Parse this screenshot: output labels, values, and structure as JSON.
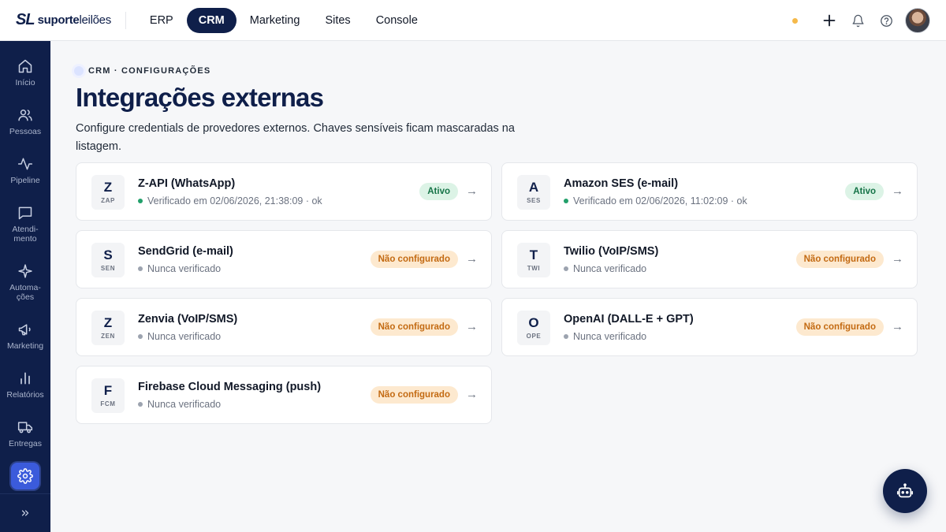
{
  "brand": {
    "mark": "SL",
    "name_bold": "suporte",
    "name_light": "leilões"
  },
  "topnav": {
    "items": [
      {
        "label": "ERP",
        "active": false
      },
      {
        "label": "CRM",
        "active": true
      },
      {
        "label": "Marketing",
        "active": false
      },
      {
        "label": "Sites",
        "active": false
      },
      {
        "label": "Console",
        "active": false
      }
    ]
  },
  "sidebar": {
    "items": [
      {
        "label": "Início",
        "icon": "home-icon"
      },
      {
        "label": "Pessoas",
        "icon": "people-icon"
      },
      {
        "label": "Pipeline",
        "icon": "pulse-icon"
      },
      {
        "label": "Atendi-\nmento",
        "icon": "chat-icon"
      },
      {
        "label": "Automa-\nções",
        "icon": "sparkle-icon"
      },
      {
        "label": "Marketing",
        "icon": "megaphone-icon"
      },
      {
        "label": "Relatórios",
        "icon": "bar-chart-icon"
      },
      {
        "label": "Entregas",
        "icon": "truck-icon"
      },
      {
        "label": "",
        "icon": "gear-icon",
        "active": true
      }
    ]
  },
  "header": {
    "breadcrumb": "CRM · CONFIGURAÇÕES",
    "title": "Integrações externas",
    "description": "Configure credentials de provedores externos. Chaves sensíveis ficam mascaradas na listagem."
  },
  "integrations": [
    {
      "letter": "Z",
      "code": "ZAP",
      "name": "Z-API (WhatsApp)",
      "status_text": "Verificado em 02/06/2026, 21:38:09 · ok",
      "verified": true,
      "badge": "Ativo"
    },
    {
      "letter": "A",
      "code": "SES",
      "name": "Amazon SES (e-mail)",
      "status_text": "Verificado em 02/06/2026, 11:02:09 · ok",
      "verified": true,
      "badge": "Ativo"
    },
    {
      "letter": "S",
      "code": "SEN",
      "name": "SendGrid (e-mail)",
      "status_text": "Nunca verificado",
      "verified": false,
      "badge": "Não configurado"
    },
    {
      "letter": "T",
      "code": "TWI",
      "name": "Twilio (VoIP/SMS)",
      "status_text": "Nunca verificado",
      "verified": false,
      "badge": "Não configurado"
    },
    {
      "letter": "Z",
      "code": "ZEN",
      "name": "Zenvia (VoIP/SMS)",
      "status_text": "Nunca verificado",
      "verified": false,
      "badge": "Não configurado"
    },
    {
      "letter": "O",
      "code": "OPE",
      "name": "OpenAI (DALL-E + GPT)",
      "status_text": "Nunca verificado",
      "verified": false,
      "badge": "Não configurado"
    },
    {
      "letter": "F",
      "code": "FCM",
      "name": "Firebase Cloud Messaging (push)",
      "status_text": "Nunca verificado",
      "verified": false,
      "badge": "Não configurado"
    }
  ],
  "colors": {
    "navy": "#0f1f4a",
    "accent": "#3b5bdb",
    "active_green": "#157347",
    "warning_orange": "#c36a12"
  }
}
